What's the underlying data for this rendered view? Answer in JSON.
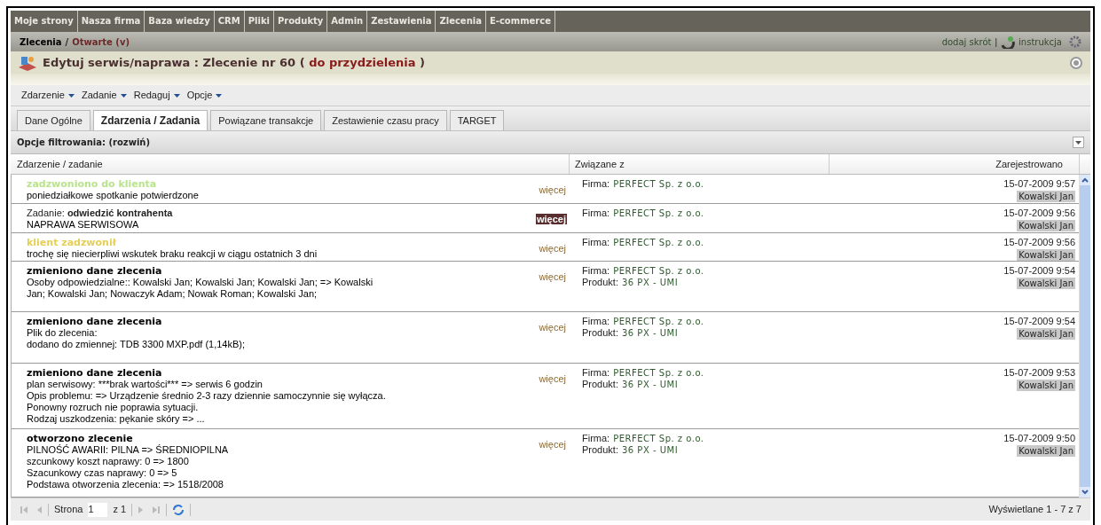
{
  "nav": [
    {
      "label": "Moje strony"
    },
    {
      "label": "Nasza firma"
    },
    {
      "label": "Baza wiedzy"
    },
    {
      "label": "CRM"
    },
    {
      "label": "Pliki"
    },
    {
      "label": "Produkty"
    },
    {
      "label": "Admin"
    },
    {
      "label": "Zestawienia"
    },
    {
      "label": "Zlecenia"
    },
    {
      "label": "E-commerce"
    }
  ],
  "breadcrumb": {
    "section": "Zlecenia",
    "separator": "/",
    "current": "Otwarte (v)"
  },
  "shortcuts": {
    "add": "dodaj skrót",
    "separator": "|",
    "help": "instrukcja"
  },
  "title": {
    "text": "Edytuj serwis/naprawa : Zlecenie nr 60 (",
    "status": "do przydzielenia",
    "close": ")"
  },
  "menu": [
    {
      "label": "Zdarzenie"
    },
    {
      "label": "Zadanie"
    },
    {
      "label": "Redaguj"
    },
    {
      "label": "Opcje"
    }
  ],
  "tabs": [
    {
      "label": "Dane Ogólne",
      "selected": false
    },
    {
      "label": "Zdarzenia / Zadania",
      "selected": true
    },
    {
      "label": "Powiązane transakcje",
      "selected": false
    },
    {
      "label": "Zestawienie czasu pracy",
      "selected": false
    },
    {
      "label": "TARGET",
      "selected": false
    }
  ],
  "filter": {
    "label": "Opcje filtrowania: (rozwiń)"
  },
  "table": {
    "columns": [
      "Zdarzenie / zadanie",
      "Związane z",
      "Zarejestrowano"
    ],
    "rows": [
      {
        "kind": "outgoing_call",
        "title": "zadzwoniono do klienta",
        "details": [
          "poniedziałkowe spotkanie potwierdzone"
        ],
        "more": "więcej",
        "more_highlighted": false,
        "related": [
          {
            "label": "Firma:",
            "value": "PERFECT Sp. z o.o."
          }
        ],
        "date": "15-07-2009 9:57",
        "user": "Kowalski Jan"
      },
      {
        "kind": "task",
        "title": "Zadanie: **odwiedzić kontrahenta**",
        "details": [
          "NAPRAWA SERWISOWA"
        ],
        "more": "więcej",
        "more_highlighted": true,
        "related": [
          {
            "label": "Firma:",
            "value": "PERFECT Sp. z o.o."
          }
        ],
        "date": "15-07-2009 9:56",
        "user": "Kowalski Jan"
      },
      {
        "kind": "incoming_call",
        "title": "klient zadzwonił",
        "details": [
          "trochę się niecierpliwi wskutek braku reakcji w ciągu ostatnich 3 dni"
        ],
        "more": "więcej",
        "more_highlighted": false,
        "related": [
          {
            "label": "Firma:",
            "value": "PERFECT Sp. z o.o."
          }
        ],
        "date": "15-07-2009 9:56",
        "user": "Kowalski Jan"
      },
      {
        "kind": "change",
        "title": "zmieniono dane zlecenia",
        "details": [
          "Osoby odpowiedzialne:: Kowalski Jan; Kowalski Jan; Kowalski Jan; => Kowalski Jan; Kowalski Jan; Nowaczyk Adam; Nowak Roman; Kowalski Jan;"
        ],
        "more": "więcej",
        "more_highlighted": false,
        "related": [
          {
            "label": "Firma:",
            "value": "PERFECT Sp. z o.o."
          },
          {
            "label": "Produkt:",
            "value": "36 PX - UMI"
          }
        ],
        "date": "15-07-2009 9:54",
        "user": "Kowalski Jan"
      },
      {
        "kind": "change",
        "title": "zmieniono dane zlecenia",
        "details": [
          "Plik do zlecenia:",
          "dodano do zmiennej: TDB 3300 MXP.pdf (1,14kB);"
        ],
        "more": "więcej",
        "more_highlighted": false,
        "related": [
          {
            "label": "Firma:",
            "value": "PERFECT Sp. z o.o."
          },
          {
            "label": "Produkt:",
            "value": "36 PX - UMI"
          }
        ],
        "date": "15-07-2009 9:54",
        "user": "Kowalski Jan"
      },
      {
        "kind": "change",
        "title": "zmieniono dane zlecenia",
        "details": [
          "plan serwisowy: ***brak wartości*** => serwis 6 godzin",
          "Opis problemu: => Urządzenie średnio 2-3 razy dziennie samoczynnie się wyłącza. Ponowny rozruch nie poprawia sytuacji.",
          "Rodzaj uszkodzenia: pękanie skóry => ..."
        ],
        "more": "więcej",
        "more_highlighted": false,
        "related": [
          {
            "label": "Firma:",
            "value": "PERFECT Sp. z o.o."
          },
          {
            "label": "Produkt:",
            "value": "36 PX - UMI"
          }
        ],
        "date": "15-07-2009 9:53",
        "user": "Kowalski Jan"
      },
      {
        "kind": "change",
        "title": "otworzono zlecenie",
        "details": [
          "PILNOŚĆ AWARII: PILNA => ŚREDNIOPILNA",
          "szcunkowy koszt naprawy: 0 => 1800",
          "Szacunkowy czas naprawy: 0 => 5",
          "Podstawa otworzenia zlecenia: => 1518/2008"
        ],
        "more": "więcej",
        "more_highlighted": false,
        "related": [
          {
            "label": "Firma:",
            "value": "PERFECT Sp. z o.o."
          },
          {
            "label": "Produkt:",
            "value": "36 PX - UMI"
          }
        ],
        "date": "15-07-2009 9:50",
        "user": "Kowalski Jan"
      }
    ]
  },
  "pager": {
    "page_label": "Strona",
    "page": "1",
    "of": "z 1",
    "summary": "Wyświetlane 1 - 7 z 7"
  }
}
